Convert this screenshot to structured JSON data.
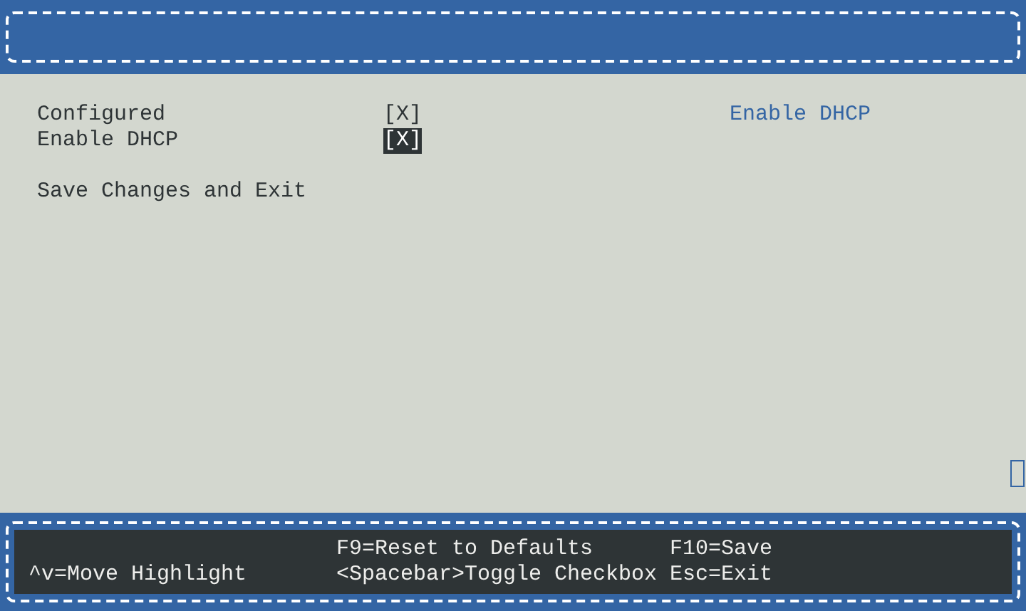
{
  "items": [
    {
      "kind": "checkbox",
      "label": "Configured",
      "value": "[X]",
      "selected": false
    },
    {
      "kind": "checkbox",
      "label": "Enable DHCP",
      "value": "[X]",
      "selected": true
    },
    {
      "kind": "action",
      "label": "Save Changes and Exit",
      "selected": false
    }
  ],
  "help_text": "Enable DHCP",
  "footer": {
    "rows": [
      [
        "",
        "F9=Reset to Defaults",
        "F10=Save"
      ],
      [
        "^v=Move Highlight",
        "<Spacebar>Toggle Checkbox",
        "Esc=Exit"
      ]
    ]
  }
}
